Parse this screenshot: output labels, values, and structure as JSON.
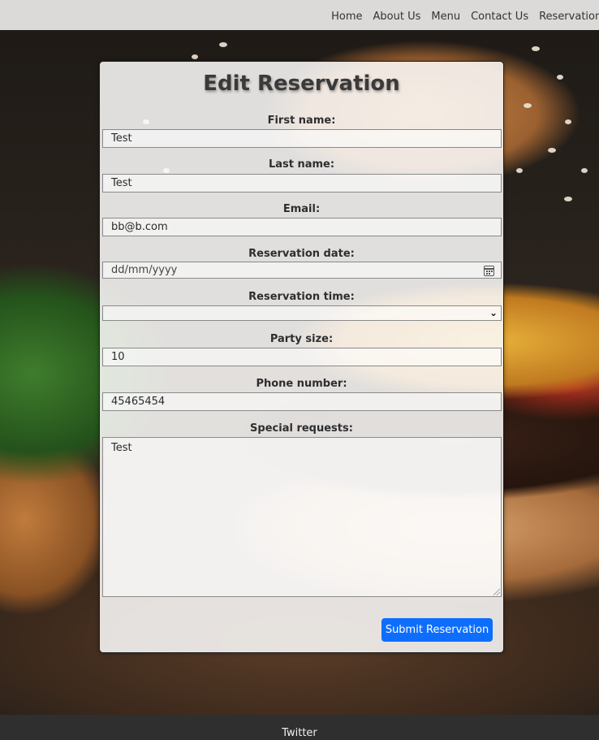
{
  "nav": {
    "items": [
      "Home",
      "About Us",
      "Menu",
      "Contact Us",
      "Reservations"
    ]
  },
  "form": {
    "title": "Edit Reservation",
    "first_name": {
      "label": "First name:",
      "value": "Test"
    },
    "last_name": {
      "label": "Last name:",
      "value": "Test"
    },
    "email": {
      "label": "Email:",
      "value": "bb@b.com"
    },
    "date": {
      "label": "Reservation date:",
      "placeholder": "dd/mm/yyyy"
    },
    "time": {
      "label": "Reservation time:",
      "value": ""
    },
    "party_size": {
      "label": "Party size:",
      "value": "10"
    },
    "phone": {
      "label": "Phone number:",
      "value": "45465454"
    },
    "special": {
      "label": "Special requests:",
      "value": "Test"
    },
    "submit_label": "Submit Reservation"
  },
  "footer": {
    "link": "Twitter"
  },
  "colors": {
    "accent": "#0d6efd",
    "nav_bg": "#ecebea",
    "footer_bg": "#2f2f2f"
  },
  "icons": {
    "date": "calendar-icon",
    "time": "chevron-down-icon"
  }
}
